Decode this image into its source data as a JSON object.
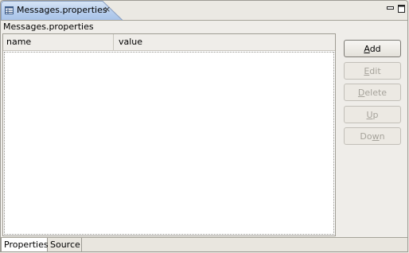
{
  "editor_tab": {
    "title": "Messages.properties",
    "icon": "properties-file-icon",
    "close_glyph": "×"
  },
  "window_controls": {
    "minimize_icon": "minimize-icon",
    "maximize_icon": "maximize-icon"
  },
  "file_label": "Messages.properties",
  "table": {
    "columns": [
      "name",
      "value"
    ],
    "rows": []
  },
  "buttons": {
    "add": {
      "pre": "",
      "mnemonic": "A",
      "post": "dd",
      "enabled": true
    },
    "edit": {
      "pre": "",
      "mnemonic": "E",
      "post": "dit",
      "enabled": false
    },
    "delete": {
      "pre": "",
      "mnemonic": "D",
      "post": "elete",
      "enabled": false
    },
    "up": {
      "pre": "",
      "mnemonic": "U",
      "post": "p",
      "enabled": false
    },
    "down": {
      "pre": "Do",
      "mnemonic": "w",
      "post": "n",
      "enabled": false
    }
  },
  "bottom_tabs": [
    {
      "label": "Properties",
      "active": true
    },
    {
      "label": "Source",
      "active": false
    }
  ],
  "colors": {
    "tab_active": "#b8cfee",
    "background": "#efede9",
    "disabled_text": "#a6a39b"
  }
}
